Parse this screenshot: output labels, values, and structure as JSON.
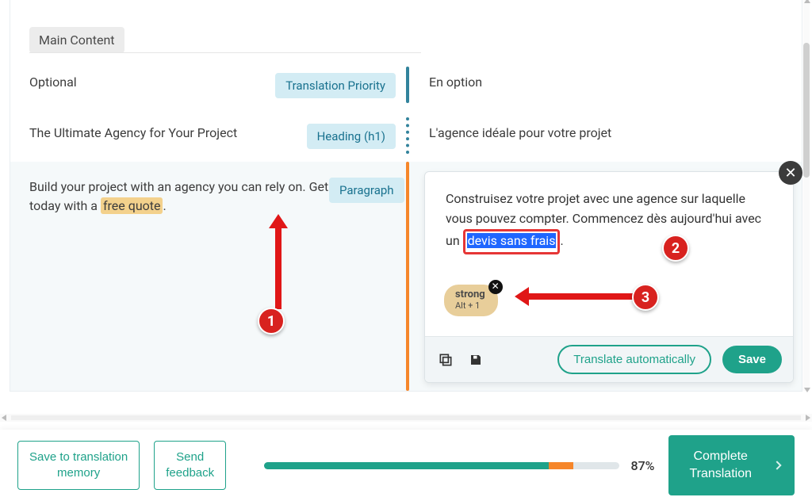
{
  "section": {
    "label": "Main Content"
  },
  "rows": {
    "r1": {
      "source": "Optional",
      "type": "Translation Priority",
      "target": "En option"
    },
    "r2": {
      "source": "The Ultimate Agency for Your Project",
      "type": "Heading (h1)",
      "target": "L'agence idéale pour votre projet"
    },
    "r3": {
      "source_pre": "Build your project with an agency you can rely on. Get started today with a ",
      "source_mark": "free quote",
      "source_post": ".",
      "type": "Paragraph",
      "target_pre": "Construisez votre projet avec une agence sur laquelle vous pouvez compter. Commencez dès aujourd'hui avec un ",
      "target_sel": "devis sans frais",
      "target_post": "."
    }
  },
  "editor": {
    "tag_name": "strong",
    "tag_hint": "Alt + 1",
    "translate_auto": "Translate automatically",
    "save": "Save"
  },
  "annotations": {
    "m1": "1",
    "m2": "2",
    "m3": "3"
  },
  "footer": {
    "save_tm_l1": "Save to translation",
    "save_tm_l2": "memory",
    "send_fb_l1": "Send",
    "send_fb_l2": "feedback",
    "percent": "87%",
    "complete_l1": "Complete",
    "complete_l2": "Translation"
  },
  "progress": {
    "green_pct": 80,
    "orange_pct": 7
  }
}
